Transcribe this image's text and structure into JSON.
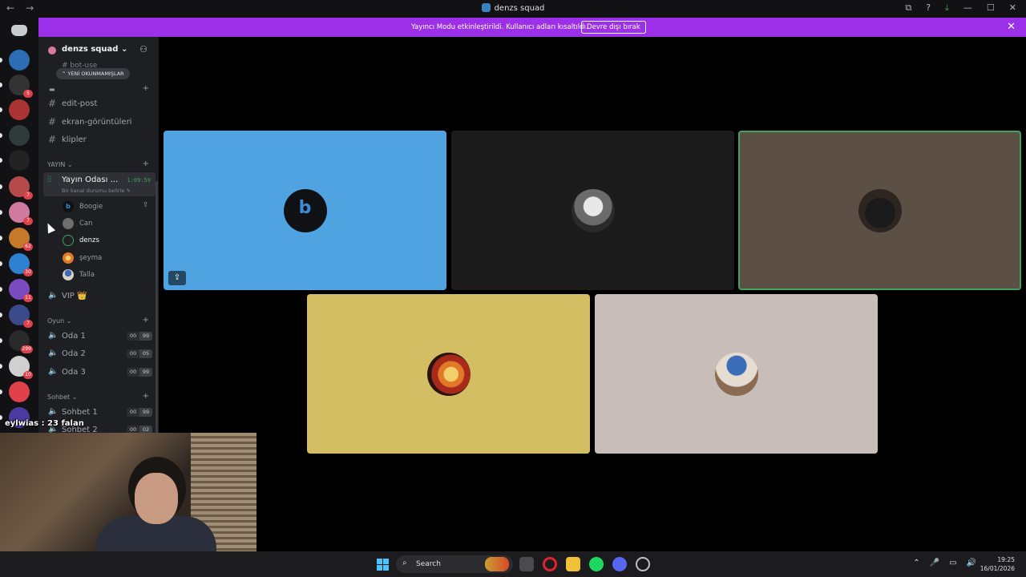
{
  "window": {
    "title": "denzs squad",
    "back_icon": "←",
    "forward_icon": "→",
    "controls": {
      "minimize": "—",
      "maximize": "☐",
      "close": "✕"
    },
    "toolbar_icons": {
      "inbox": "⧉",
      "help": "?",
      "download": "⤓"
    }
  },
  "banner": {
    "text": "Yayıncı Modu etkinleştirildi. Kullanıcı adları kısaltıldı.",
    "button": "Devre dışı bırak",
    "close": "✕"
  },
  "server_rail": {
    "home_icon": "discord-logo",
    "servers": [
      {
        "name": "server-1",
        "color": "#2c6db3",
        "badge": "",
        "top": 0
      },
      {
        "name": "server-2",
        "color": "#333",
        "badge": "5"
      },
      {
        "name": "server-3",
        "color": "#a33",
        "badge": ""
      },
      {
        "name": "server-4",
        "color": "#2f3a3a",
        "badge": ""
      },
      {
        "name": "server-5",
        "color": "#222",
        "badge": ""
      },
      {
        "name": "server-6",
        "color": "#b54a4a",
        "badge": "7"
      },
      {
        "name": "server-7",
        "color": "#d07aa0",
        "badge": "7"
      },
      {
        "name": "server-8",
        "color": "#c47a2a",
        "badge": "62"
      },
      {
        "name": "server-9",
        "color": "#2e80d0",
        "badge": "30"
      },
      {
        "name": "server-10",
        "color": "#7a4ac0",
        "badge": "11"
      },
      {
        "name": "server-11",
        "color": "#3a4a8a",
        "badge": "7"
      },
      {
        "name": "server-12",
        "color": "#2a2a2a",
        "badge": "299"
      },
      {
        "name": "server-13",
        "color": "#d0d0d0",
        "badge": "10"
      },
      {
        "name": "server-14",
        "color": "#e0404a",
        "badge": ""
      },
      {
        "name": "server-15",
        "color": "#4b3aa0",
        "badge": ""
      }
    ]
  },
  "sidebar": {
    "server_name": "denzs squad",
    "server_chevron": "⌄",
    "unread_pill": "⌃ YENİ OKUNMAMIŞLAR",
    "faded_channel": "bot-use",
    "folder_icon": "▬",
    "text_channels": [
      "edit-post",
      "ekran-görüntüleri",
      "klipler"
    ],
    "categories": {
      "yayin": "YAYIN ⌄",
      "oyun": "Oyun ⌄",
      "sohbet": "Sohbet ⌄"
    },
    "active_voice": {
      "name": "Yayın Odası ...",
      "time": "1:09:59",
      "status": "Bir kanal durumu belirle ✎"
    },
    "members": [
      {
        "name": "Boogie",
        "color": "#0f1114"
      },
      {
        "name": "Can",
        "color": "#777"
      },
      {
        "name": "denzs",
        "color": "#1e1f22"
      },
      {
        "name": "şeyma",
        "color": "#e0902a"
      },
      {
        "name": "Talla",
        "color": "#3a6cb8"
      }
    ],
    "vip_channel": "VIP 👑",
    "oyun_channels": [
      {
        "name": "Oda 1",
        "a": "00",
        "b": "99"
      },
      {
        "name": "Oda 2",
        "a": "00",
        "b": "05"
      },
      {
        "name": "Oda 3",
        "a": "00",
        "b": "99"
      }
    ],
    "sohbet_channels": [
      {
        "name": "Sohbet 1",
        "a": "00",
        "b": "99"
      },
      {
        "name": "Sohbet 2",
        "a": "00",
        "b": "02"
      }
    ]
  },
  "call": {
    "participants": [
      "Boogie",
      "Can",
      "cat-avatar",
      "fire-avatar",
      "hat-cat-avatar"
    ],
    "boogie_glyph": "b"
  },
  "stream_overlay": {
    "chat_line": "eylwias : 23 falan"
  },
  "taskbar": {
    "search_placeholder": "Search",
    "time": "19:25",
    "date": "16/01/2026",
    "tray_icons": [
      "⌃",
      "🎤",
      "▭",
      "🔊"
    ]
  }
}
